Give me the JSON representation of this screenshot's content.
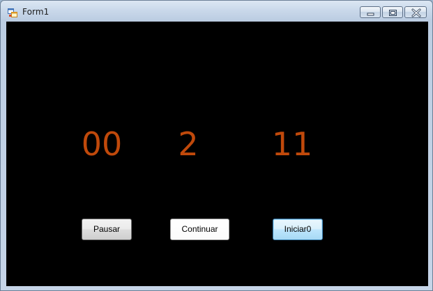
{
  "window": {
    "title": "Form1"
  },
  "counters": {
    "first": "00",
    "second": "2",
    "third": "11"
  },
  "buttons": {
    "pause_label": "Pausar",
    "continue_label": "Continuar",
    "start_label": "Iniciar0"
  },
  "colors": {
    "counter_text": "#c0490b",
    "form_background": "#000000"
  },
  "icons": {
    "app": "form-app-icon",
    "minimize": "minimize-icon",
    "maximize": "maximize-icon",
    "close": "close-icon"
  }
}
